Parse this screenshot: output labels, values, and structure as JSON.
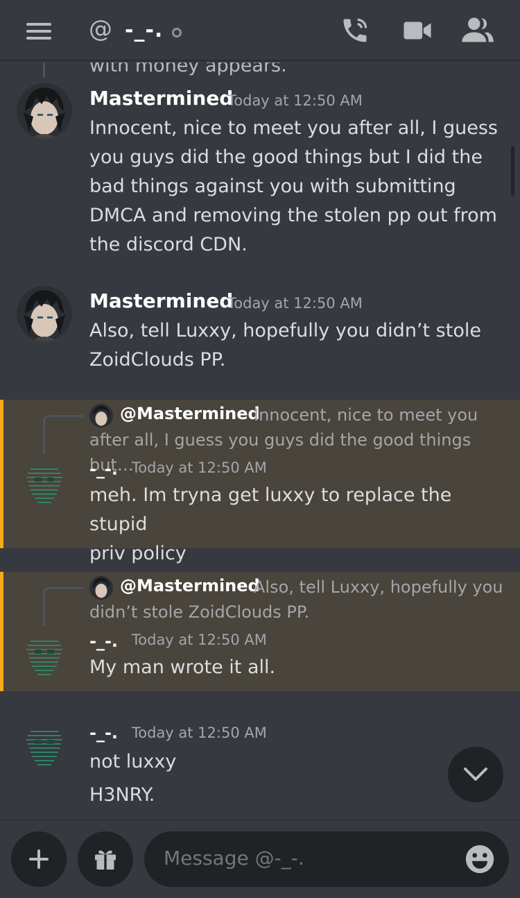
{
  "header": {
    "at_symbol": "@",
    "dm_name": "-_-.",
    "icons": [
      "hamburger-menu-icon",
      "call-icon",
      "video-call-icon",
      "members-icon"
    ]
  },
  "messages": [
    {
      "truncated_text": "with money appears."
    },
    {
      "author": "Mastermined",
      "timestamp": "Today at 12:50 AM",
      "lines": [
        "Innocent, nice to meet you after all, I guess",
        "you guys did the good things but I did the",
        "bad things against you with submitting",
        "DMCA and removing the stolen pp out from",
        "the discord CDN."
      ]
    },
    {
      "author": "Mastermined",
      "timestamp": "Today at 12:50 AM",
      "lines": [
        "Also, tell Luxxy, hopefully you didn’t stole",
        "ZoidClouds PP."
      ]
    },
    {
      "reply_to": "@Mastermined",
      "reply_lines": [
        "Innocent, nice to meet you",
        "after all, I guess you guys did the good things but…"
      ],
      "author": "-_-.",
      "timestamp": "Today at 12:50 AM",
      "lines": [
        "meh. Im tryna get luxxy to replace the stupid",
        "priv policy"
      ]
    },
    {
      "reply_to": "@Mastermined",
      "reply_lines": [
        "Also, tell Luxxy, hopefully you",
        "didn’t stole ZoidClouds PP."
      ],
      "author": "-_-.",
      "timestamp": "Today at 12:50 AM",
      "lines": [
        "My man wrote it all."
      ]
    },
    {
      "author": "-_-.",
      "timestamp": "Today at 12:50 AM",
      "lines": [
        "not luxxy",
        "H3NRY."
      ]
    }
  ],
  "composer": {
    "placeholder": "Message @-_-.",
    "icons": [
      "plus-icon",
      "gift-icon",
      "emoji-icon"
    ]
  },
  "colors": {
    "background": "#36393f",
    "mention_highlight": "#49443c",
    "mention_bar": "#faa81a",
    "input_bg": "#202225"
  }
}
